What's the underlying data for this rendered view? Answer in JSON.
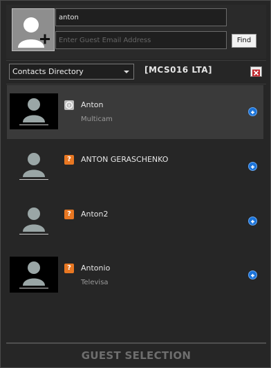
{
  "search": {
    "name_value": "anton",
    "email_placeholder": "Enter Guest Email Address",
    "find_label": "Find"
  },
  "directory": {
    "selected": "Contacts Directory",
    "room_label": "[MCS016 LTA]"
  },
  "contacts": [
    {
      "name": "Anton",
      "subtitle": "Multicam",
      "status_icon": "info-icon",
      "selected": true
    },
    {
      "name": "ANTON GERASCHENKO",
      "subtitle": "",
      "status_icon": "question-icon",
      "selected": false
    },
    {
      "name": "Anton2",
      "subtitle": "",
      "status_icon": "question-icon",
      "selected": false
    },
    {
      "name": "Antonio",
      "subtitle": "Televisa",
      "status_icon": "question-icon",
      "selected": false
    }
  ],
  "status_glyphs": {
    "question": "?"
  },
  "footer": {
    "title": "GUEST SELECTION"
  },
  "colors": {
    "accent_blue": "#1a73d9",
    "status_orange": "#e87722",
    "selected_row": "#3a3a3a"
  }
}
